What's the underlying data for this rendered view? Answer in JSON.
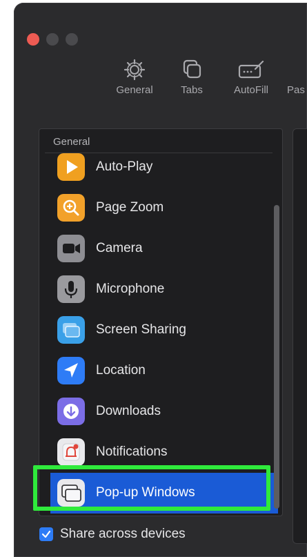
{
  "toolbar": {
    "items": [
      {
        "label": "General",
        "icon": "gear-icon"
      },
      {
        "label": "Tabs",
        "icon": "tabs-icon"
      },
      {
        "label": "AutoFill",
        "icon": "autofill-icon"
      },
      {
        "label": "Pas",
        "icon": ""
      }
    ]
  },
  "sidebar": {
    "section_title": "General",
    "items": [
      {
        "label": "Auto-Play",
        "icon": "play-icon",
        "color": "#f0a020"
      },
      {
        "label": "Page Zoom",
        "icon": "zoom-icon",
        "color": "#f2a12a"
      },
      {
        "label": "Camera",
        "icon": "camera-icon",
        "color": "#8e8e93"
      },
      {
        "label": "Microphone",
        "icon": "microphone-icon",
        "color": "#9a9a9e"
      },
      {
        "label": "Screen Sharing",
        "icon": "screen-sharing-icon",
        "color": "#3aa0e8"
      },
      {
        "label": "Location",
        "icon": "location-icon",
        "color": "#2e7cf6"
      },
      {
        "label": "Downloads",
        "icon": "downloads-icon",
        "color": "#7b6de6"
      },
      {
        "label": "Notifications",
        "icon": "notifications-icon",
        "color": "#e9e9ec"
      },
      {
        "label": "Pop-up Windows",
        "icon": "popup-windows-icon",
        "color": "#e9e9ec",
        "selected": true
      }
    ]
  },
  "share": {
    "label": "Share across devices",
    "checked": true
  },
  "colors": {
    "selection": "#1a5bd6",
    "highlight": "#2fea3c",
    "window_bg": "#2b2b2d",
    "list_bg": "#1e1e20"
  }
}
